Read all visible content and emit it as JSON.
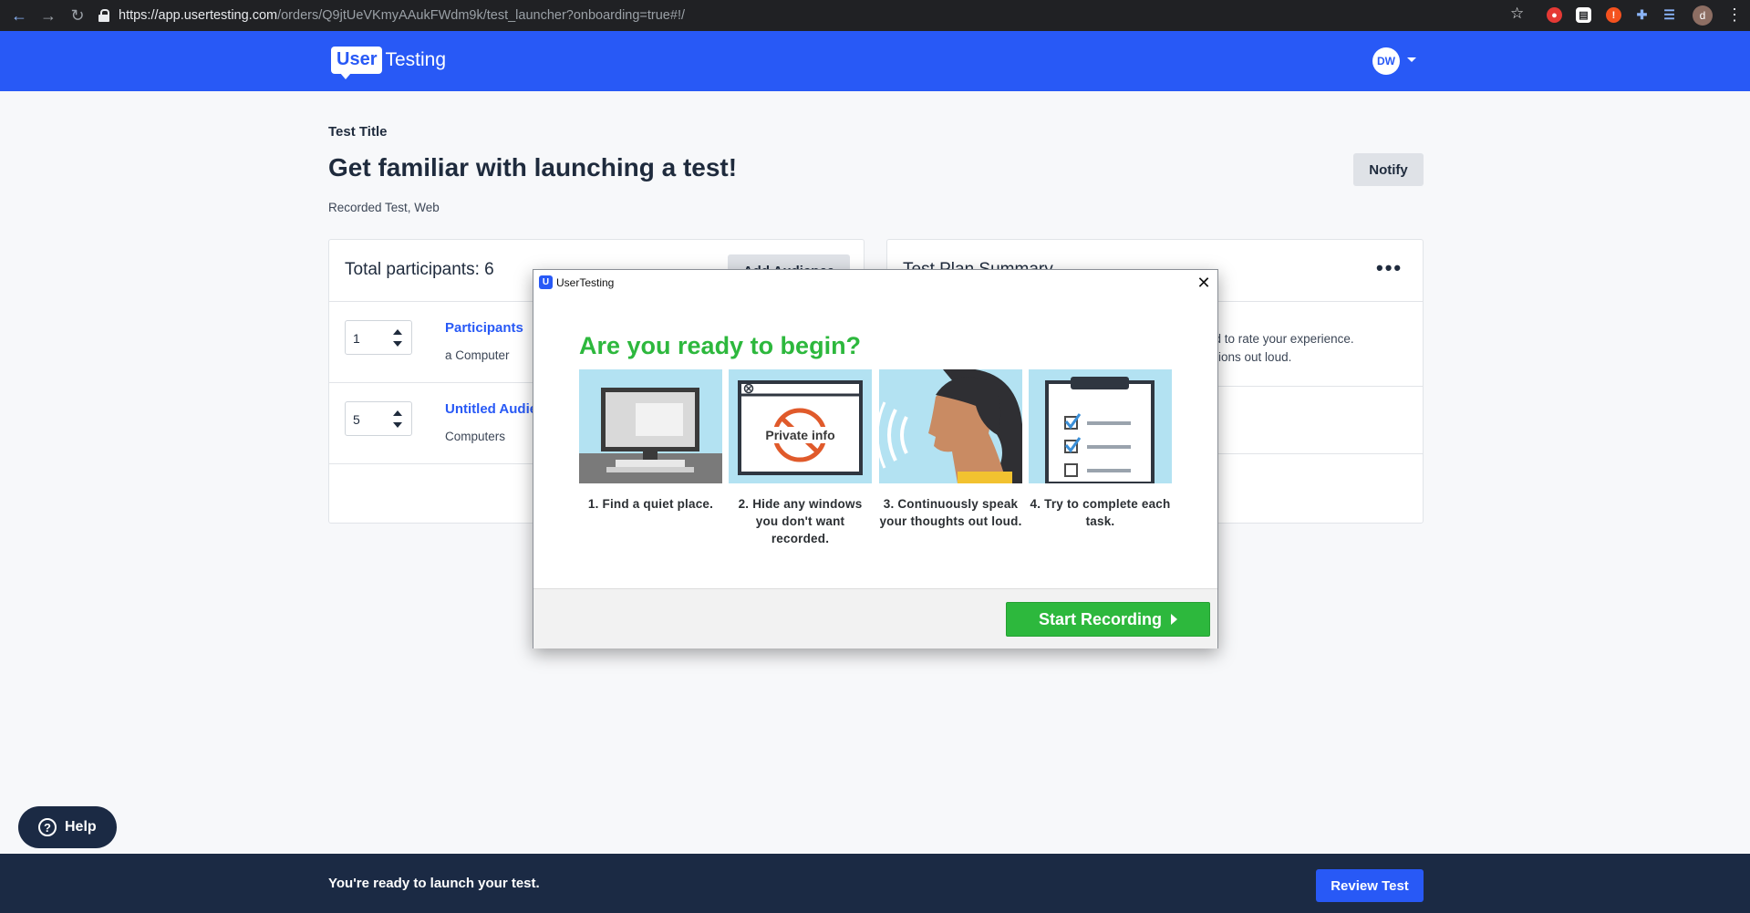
{
  "browser": {
    "url_host": "https://app.usertesting.com",
    "url_path": "/orders/Q9jtUeVKmyAAukFWdm9k/test_launcher?onboarding=true#!/",
    "profile_initial": "d"
  },
  "header": {
    "logo_box": "User",
    "logo_text": "Testing",
    "avatar_initials": "DW"
  },
  "page": {
    "eyebrow": "Test Title",
    "title": "Get familiar with launching a test!",
    "subtitle": "Recorded Test, Web",
    "notify_label": "Notify"
  },
  "participants_card": {
    "total_label": "Total participants: 6",
    "add_audience_label": "Add Audience",
    "rows": [
      {
        "count": "1",
        "name": "Participants",
        "meta": "a Computer"
      },
      {
        "count": "5",
        "name": "Untitled Audience",
        "meta": "Computers"
      }
    ]
  },
  "plan_card": {
    "title": "Test Plan Summary",
    "line1": "asked to rate your experience.",
    "line2": "questions out loud."
  },
  "help": {
    "label": "Help"
  },
  "footer": {
    "message": "You're ready to launch your test.",
    "review_label": "Review Test"
  },
  "modal": {
    "app_name": "UserTesting",
    "heading": "Are you ready to begin?",
    "private_label": "Private info",
    "steps": [
      "1. Find a quiet place.",
      "2. Hide any windows you don't want recorded.",
      "3. Continuously speak your thoughts out loud.",
      "4. Try to complete each task."
    ],
    "start_label": "Start Recording"
  },
  "colors": {
    "brand_blue": "#2859f6",
    "navy": "#1b2a44",
    "go_green": "#2db83d",
    "step_bg": "#b3e2f2"
  }
}
